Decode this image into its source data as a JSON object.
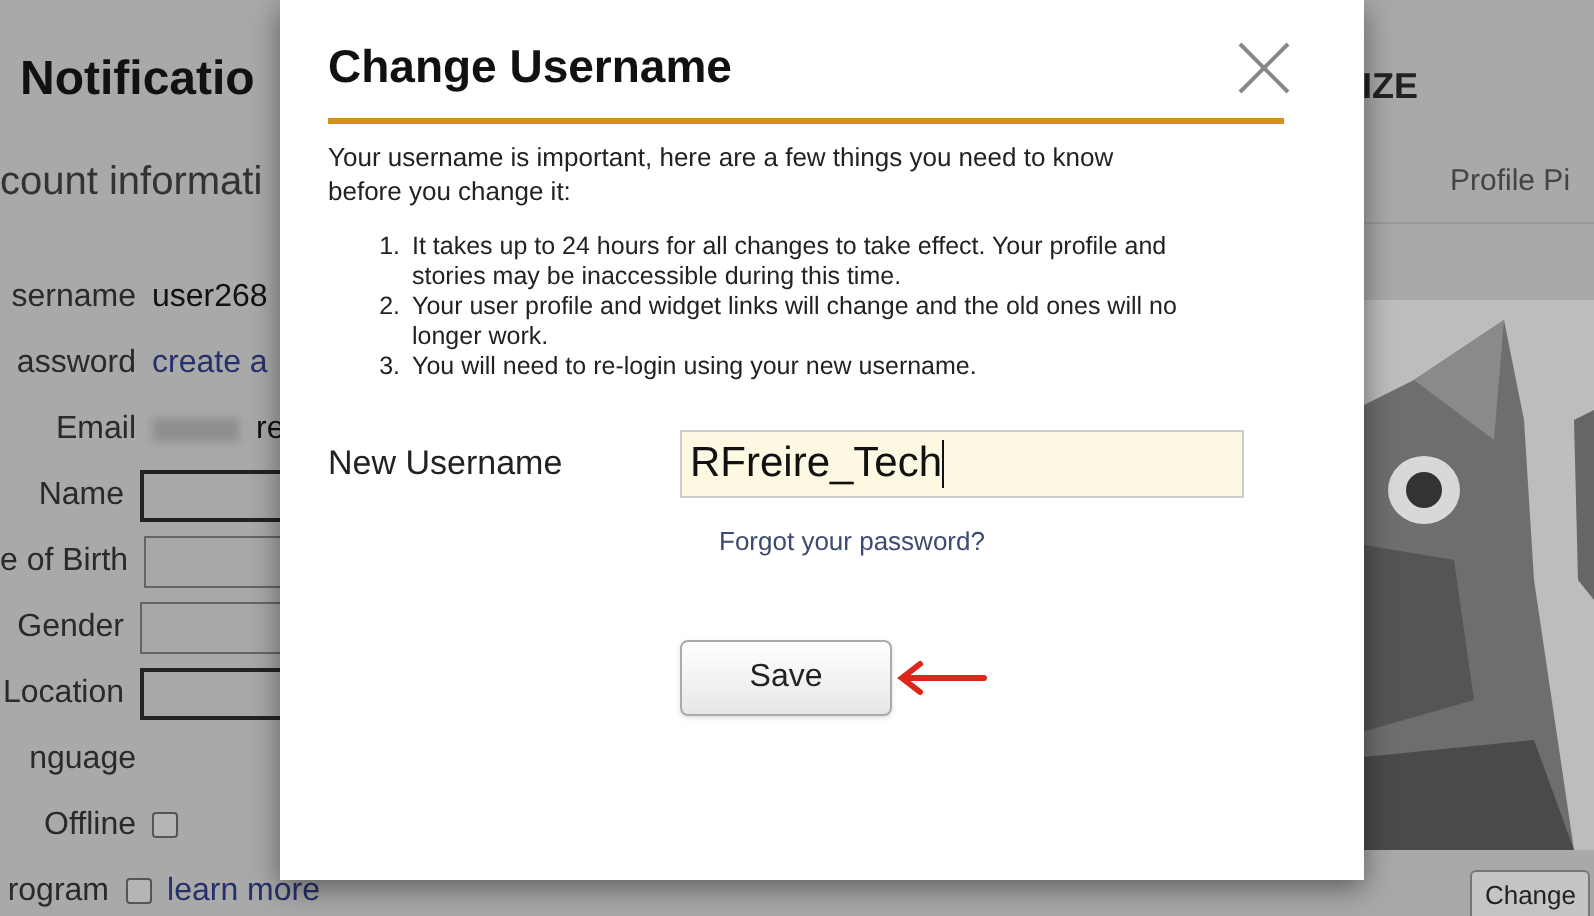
{
  "background_page": {
    "title": "Notificatio",
    "section": "count informati",
    "fields": [
      {
        "label": "sername",
        "kind": "text",
        "value": "user268"
      },
      {
        "label": "assword",
        "kind": "link",
        "value": "create a"
      },
      {
        "label": "Email",
        "kind": "redacted",
        "value": "re"
      },
      {
        "label": "Name",
        "kind": "input"
      },
      {
        "label": "e of Birth",
        "kind": "input"
      },
      {
        "label": "Gender",
        "kind": "input"
      },
      {
        "label": "Location",
        "kind": "input"
      },
      {
        "label": "nguage",
        "kind": "label"
      },
      {
        "label": "Offline",
        "kind": "checkbox",
        "checked": false
      },
      {
        "label": "rogram",
        "kind": "checkbox",
        "checked": false,
        "link": "learn more"
      }
    ]
  },
  "customize_panel": {
    "title": "IZE",
    "column": "Profile Pi",
    "button": "Change"
  },
  "dialog": {
    "title": "Change Username",
    "intro": "Your username is important, here are a few things you need to know before you change it:",
    "steps": [
      {
        "number": "1.",
        "text": "It takes up to 24 hours for all changes to take effect. Your profile and stories may be inaccessible during this time."
      },
      {
        "number": "2.",
        "text": "Your user profile and widget links will change and the old ones will no longer work."
      },
      {
        "number": "3.",
        "text": "You will need to re-login using your new username."
      }
    ],
    "field_label": "New Username",
    "field_value": "RFreire_Tech",
    "forgot_link": "Forgot your password?",
    "save_button": "Save"
  }
}
